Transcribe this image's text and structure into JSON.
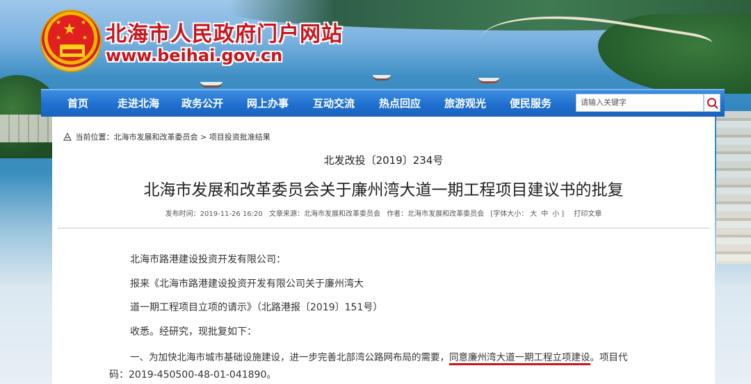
{
  "header": {
    "site_title": "北海市人民政府门户网站",
    "site_url": "www.beihai.gov.cn"
  },
  "nav": {
    "items": [
      "首页",
      "走进北海",
      "政务公开",
      "网上办事",
      "互动交流",
      "热点回应",
      "旅游观光",
      "便民服务"
    ],
    "search_placeholder": "请输入关键字"
  },
  "breadcrumb": {
    "prefix": "当前位置：",
    "level1": "北海市发展和改革委员会",
    "sep": ">",
    "level2": "项目投资批准结果"
  },
  "article": {
    "doc_number": "北发改投〔2019〕234号",
    "title": "北海市发展和改革委员会关于廉州湾大道一期工程项目建议书的批复",
    "meta": {
      "publish_time": "发布时间：2019-11-26 16:20",
      "source": "文章来源：北海市发展和改革委员会",
      "author": "作者：北海市发展和改革委员会",
      "font_size_label": "[字体大小：",
      "size_large": "大",
      "size_medium": "中",
      "size_small": "小",
      "font_size_close": "]",
      "print": "打印文章"
    },
    "paragraphs": {
      "p1": "北海市路港建设投资开发有限公司：",
      "p2": "报来《北海市路港建设投资开发有限公司关于廉州湾大",
      "p3": "道一期工程项目立项的请示》（北路港报〔2019〕151号）",
      "p4": "收悉。经研究，现批复如下：",
      "p5_a": "一、为加快北海市城市基础设施建设，进一步完善北部湾公路网布局的需要，",
      "p5_highlight": "同意廉州湾大道一期工程立项建设",
      "p5_b": "。项目代",
      "p6": "码：2019-450500-48-01-041890。"
    }
  },
  "colors": {
    "nav_blue": "#1f6fcf",
    "title_red": "#c8151c",
    "highlight_underline": "#d0121b"
  }
}
